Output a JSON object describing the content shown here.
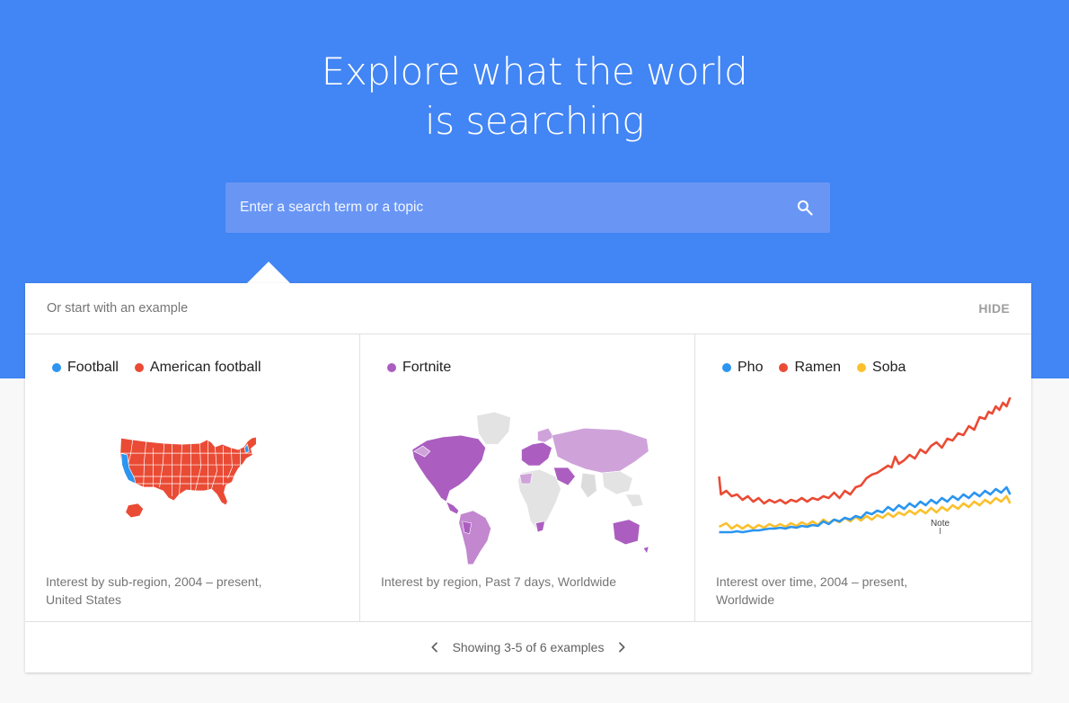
{
  "hero": {
    "title_line1": "Explore what the world",
    "title_line2": "is searching"
  },
  "search": {
    "placeholder": "Enter a search term or a topic",
    "value": "",
    "icon": "search-icon"
  },
  "examples": {
    "header_text": "Or start with an example",
    "hide_label": "HIDE",
    "cards": [
      {
        "legend": [
          {
            "label": "Football",
            "color": "#2b95f0"
          },
          {
            "label": "American football",
            "color": "#ea4b35"
          }
        ],
        "caption": "Interest by sub-region, 2004 – present, United States"
      },
      {
        "legend": [
          {
            "label": "Fortnite",
            "color": "#ab5ec0"
          }
        ],
        "caption": "Interest by region, Past 7 days, Worldwide"
      },
      {
        "legend": [
          {
            "label": "Pho",
            "color": "#2b95f0"
          },
          {
            "label": "Ramen",
            "color": "#ea4b35"
          },
          {
            "label": "Soba",
            "color": "#fbc02d"
          }
        ],
        "caption": "Interest over time, 2004 – present, Worldwide",
        "note_label": "Note"
      }
    ],
    "pager_text": "Showing 3-5 of 6 examples"
  },
  "colors": {
    "hero_bg": "#4285f4",
    "search_bg": "#6996f5",
    "blue": "#2b95f0",
    "red": "#ea4b35",
    "yellow": "#fbc02d",
    "purple": "#ab5ec0"
  }
}
